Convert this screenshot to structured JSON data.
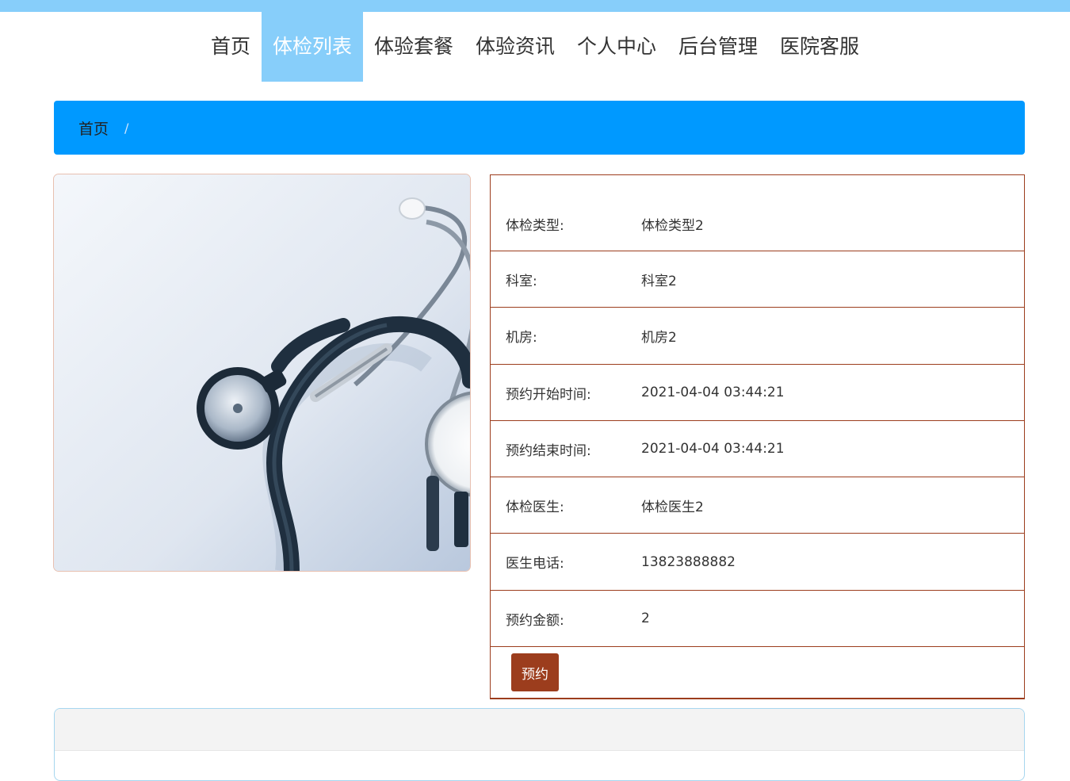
{
  "nav": {
    "items": [
      {
        "label": "首页",
        "active": false
      },
      {
        "label": "体检列表",
        "active": true
      },
      {
        "label": "体验套餐",
        "active": false
      },
      {
        "label": "体验资讯",
        "active": false
      },
      {
        "label": "个人中心",
        "active": false
      },
      {
        "label": "后台管理",
        "active": false
      },
      {
        "label": "医院客服",
        "active": false
      }
    ]
  },
  "breadcrumb": {
    "home": "首页",
    "separator": "/"
  },
  "detail": {
    "rows": [
      {
        "label": "体检类型:",
        "value": "体检类型2"
      },
      {
        "label": "科室:",
        "value": "科室2"
      },
      {
        "label": "机房:",
        "value": "机房2"
      },
      {
        "label": "预约开始时间:",
        "value": "2021-04-04 03:44:21"
      },
      {
        "label": "预约结束时间:",
        "value": "2021-04-04 03:44:21"
      },
      {
        "label": "体检医生:",
        "value": "体检医生2"
      },
      {
        "label": "医生电话:",
        "value": "13823888882"
      },
      {
        "label": "预约金额:",
        "value": "2"
      }
    ],
    "book_label": "预约"
  },
  "colors": {
    "nav_active": "#87cefa",
    "breadcrumb_bg": "#0099ff",
    "accent": "#9c3d1d"
  }
}
